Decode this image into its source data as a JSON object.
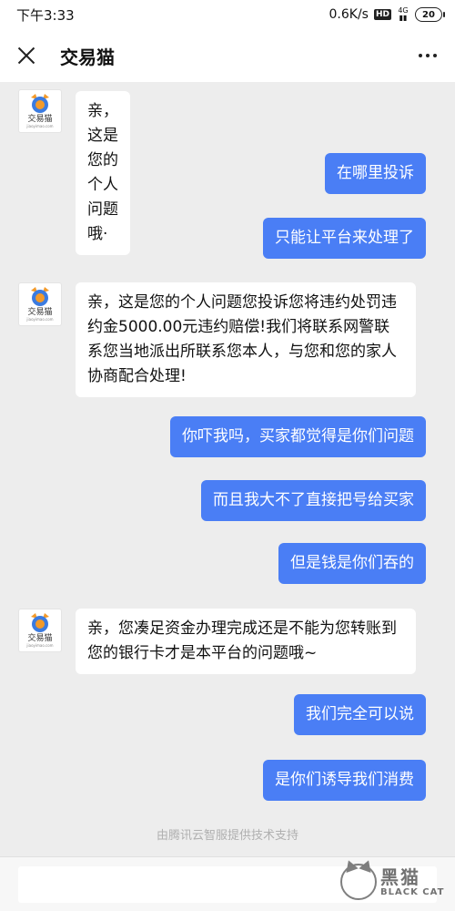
{
  "status_bar": {
    "time": "下午3:33",
    "speed": "0.6K/s",
    "hd": "HD",
    "network": "4G",
    "battery": "20"
  },
  "header": {
    "title": "交易猫"
  },
  "avatar": {
    "label": "交易猫",
    "sub": "jiaoyimao.com"
  },
  "messages": [
    {
      "side": "left",
      "text": "亲，这是您的个人问题哦·"
    },
    {
      "side": "right",
      "text": "在哪里投诉"
    },
    {
      "side": "right",
      "text": "只能让平台来处理了"
    },
    {
      "side": "left",
      "text": "亲，这是您的个人问题您投诉您将违约处罚违约金5000.00元违约赔偿!我们将联系网警联系您当地派出所联系您本人，与您和您的家人协商配合处理!"
    },
    {
      "side": "right",
      "text": "你吓我吗，买家都觉得是你们问题"
    },
    {
      "side": "right",
      "text": "而且我大不了直接把号给买家"
    },
    {
      "side": "right",
      "text": "但是钱是你们吞的"
    },
    {
      "side": "left",
      "text": "亲，您凑足资金办理完成还是不能为您转账到您的银行卡才是本平台的问题哦~"
    },
    {
      "side": "right",
      "text": "我们完全可以说"
    },
    {
      "side": "right",
      "text": "是你们诱导我们消费"
    }
  ],
  "footer_note": "由腾讯云智服提供技术支持",
  "watermark": {
    "cn": "黑猫",
    "en": "BLACK CAT"
  },
  "colors": {
    "bubble_right": "#4a7ef5",
    "bubble_left": "#ffffff",
    "background": "#ededed"
  }
}
